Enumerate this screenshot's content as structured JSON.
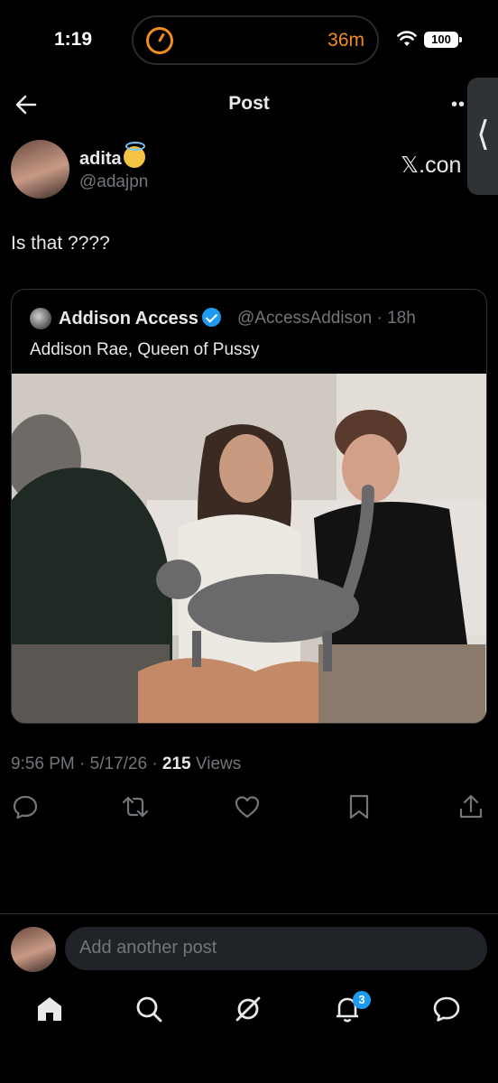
{
  "status_bar": {
    "time": "1:19",
    "timer_label": "36m",
    "battery": "100",
    "timer_color": "#f28c1d"
  },
  "header": {
    "title": "Post"
  },
  "post": {
    "author_name": "adita",
    "author_handle": "@adajpn",
    "watermark": "𝕏.con",
    "text": "Is that ????",
    "timestamp": "9:56 PM · 5/17/26 · ",
    "views_count": "215",
    "views_label": " Views"
  },
  "quote": {
    "name": "Addison Access",
    "handle": "@AccessAddison · 18h",
    "text": "Addison Rae, Queen of Pussy"
  },
  "actions": [
    "reply-icon",
    "repost-icon",
    "like-icon",
    "bookmark-icon",
    "share-icon"
  ],
  "composer": {
    "placeholder": "Add another post"
  },
  "bottom_nav": {
    "notifications_badge": "3"
  },
  "colors": {
    "accent": "#1d9bf0",
    "muted": "#71767b",
    "text": "#e7e9ea",
    "background": "#000000"
  }
}
